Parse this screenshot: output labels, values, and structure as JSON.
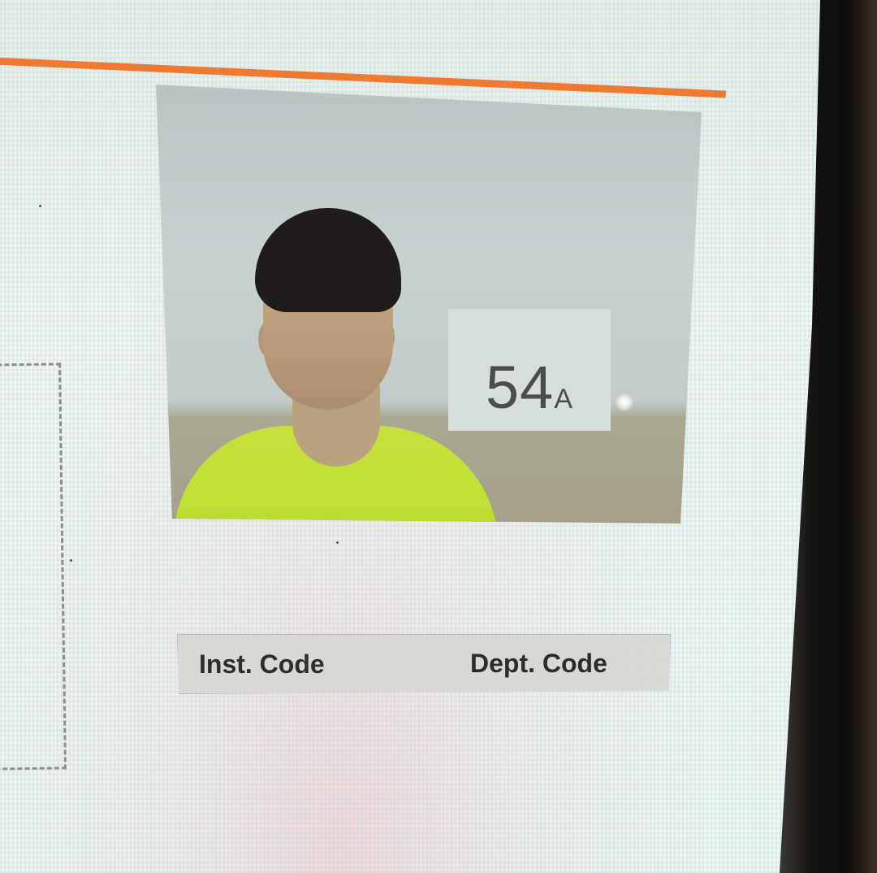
{
  "photo_panel": {
    "sign_text": "54",
    "sign_suffix": "A"
  },
  "codes_bar": {
    "inst_label": "Inst. Code",
    "dept_label": "Dept. Code"
  },
  "colors": {
    "accent_rule": "#ef7b33",
    "bar_background": "#d6d6d2",
    "label_text": "#2d2d2d"
  }
}
